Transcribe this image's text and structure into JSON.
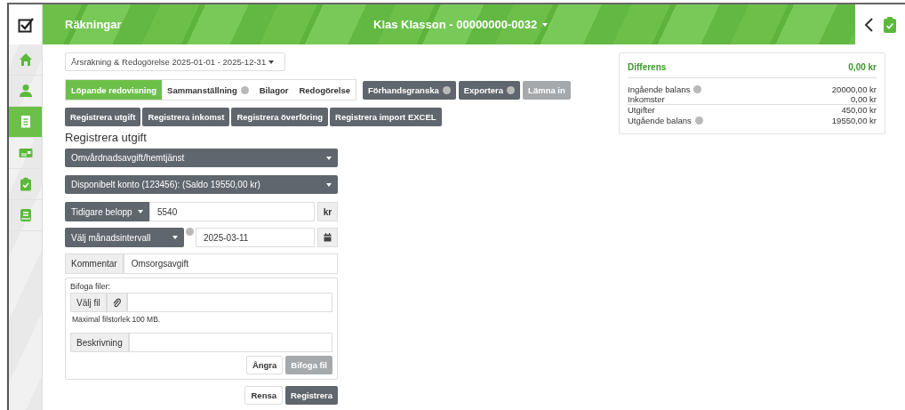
{
  "header": {
    "title": "Räkningar",
    "client": "Klas Klasson - 00000000-0032"
  },
  "sidebar": {
    "items": [
      {
        "kind": "home",
        "selected": false
      },
      {
        "kind": "person",
        "selected": false
      },
      {
        "kind": "receipt",
        "selected": true
      },
      {
        "kind": "card",
        "selected": false
      },
      {
        "kind": "clipboard",
        "selected": false
      },
      {
        "kind": "book",
        "selected": false
      }
    ]
  },
  "period": "Årsräkning & Redogörelse 2025-01-01 - 2025-12-31",
  "tabs": [
    {
      "label": "Löpande redovisning",
      "selected": true,
      "info": false
    },
    {
      "label": "Sammanställning",
      "selected": false,
      "info": true
    },
    {
      "label": "Bilagor",
      "selected": false,
      "info": false
    },
    {
      "label": "Redogörelse",
      "selected": false,
      "info": false
    }
  ],
  "actions": [
    {
      "label": "Förhandsgranska",
      "info": true,
      "disabled": false
    },
    {
      "label": "Exportera",
      "info": true,
      "disabled": false
    },
    {
      "label": "Lämna in",
      "info": false,
      "disabled": true
    }
  ],
  "register_buttons": [
    "Registrera utgift",
    "Registrera inkomst",
    "Registrera överföring",
    "Registrera import EXCEL"
  ],
  "form": {
    "heading": "Registrera utgift",
    "category": "Omvårdnadsavgift/hemtjänst",
    "account": "Disponibelt konto (123456): (Saldo 19550,00 kr)",
    "amount_type": "Tidigare belopp",
    "amount": "5540",
    "currency": "kr",
    "interval": "Välj månadsintervall",
    "date": "2025-03-11",
    "comment_label": "Kommentar",
    "comment": "Omsorgsavgift",
    "attach": {
      "title": "Bifoga filer:",
      "choose_file": "Välj fil",
      "max_size": "Maximal filstorlek 100 MB.",
      "description_label": "Beskrivning",
      "undo": "Ångra",
      "attach_button": "Bifoga fil",
      "attach_disabled": true
    },
    "clear": "Rensa",
    "submit": "Registrera"
  },
  "summary": {
    "title": "Differens",
    "total": "0,00 kr",
    "rows": [
      {
        "label": "Ingående balans",
        "value": "20000,00 kr",
        "info": true
      },
      {
        "label": "Inkomster",
        "value": "0,00 kr",
        "info": false
      },
      {
        "label": "Utgifter",
        "value": "450,00 kr",
        "info": false
      },
      {
        "label": "Utgående balans",
        "value": "19550,00 kr",
        "info": true
      }
    ]
  }
}
